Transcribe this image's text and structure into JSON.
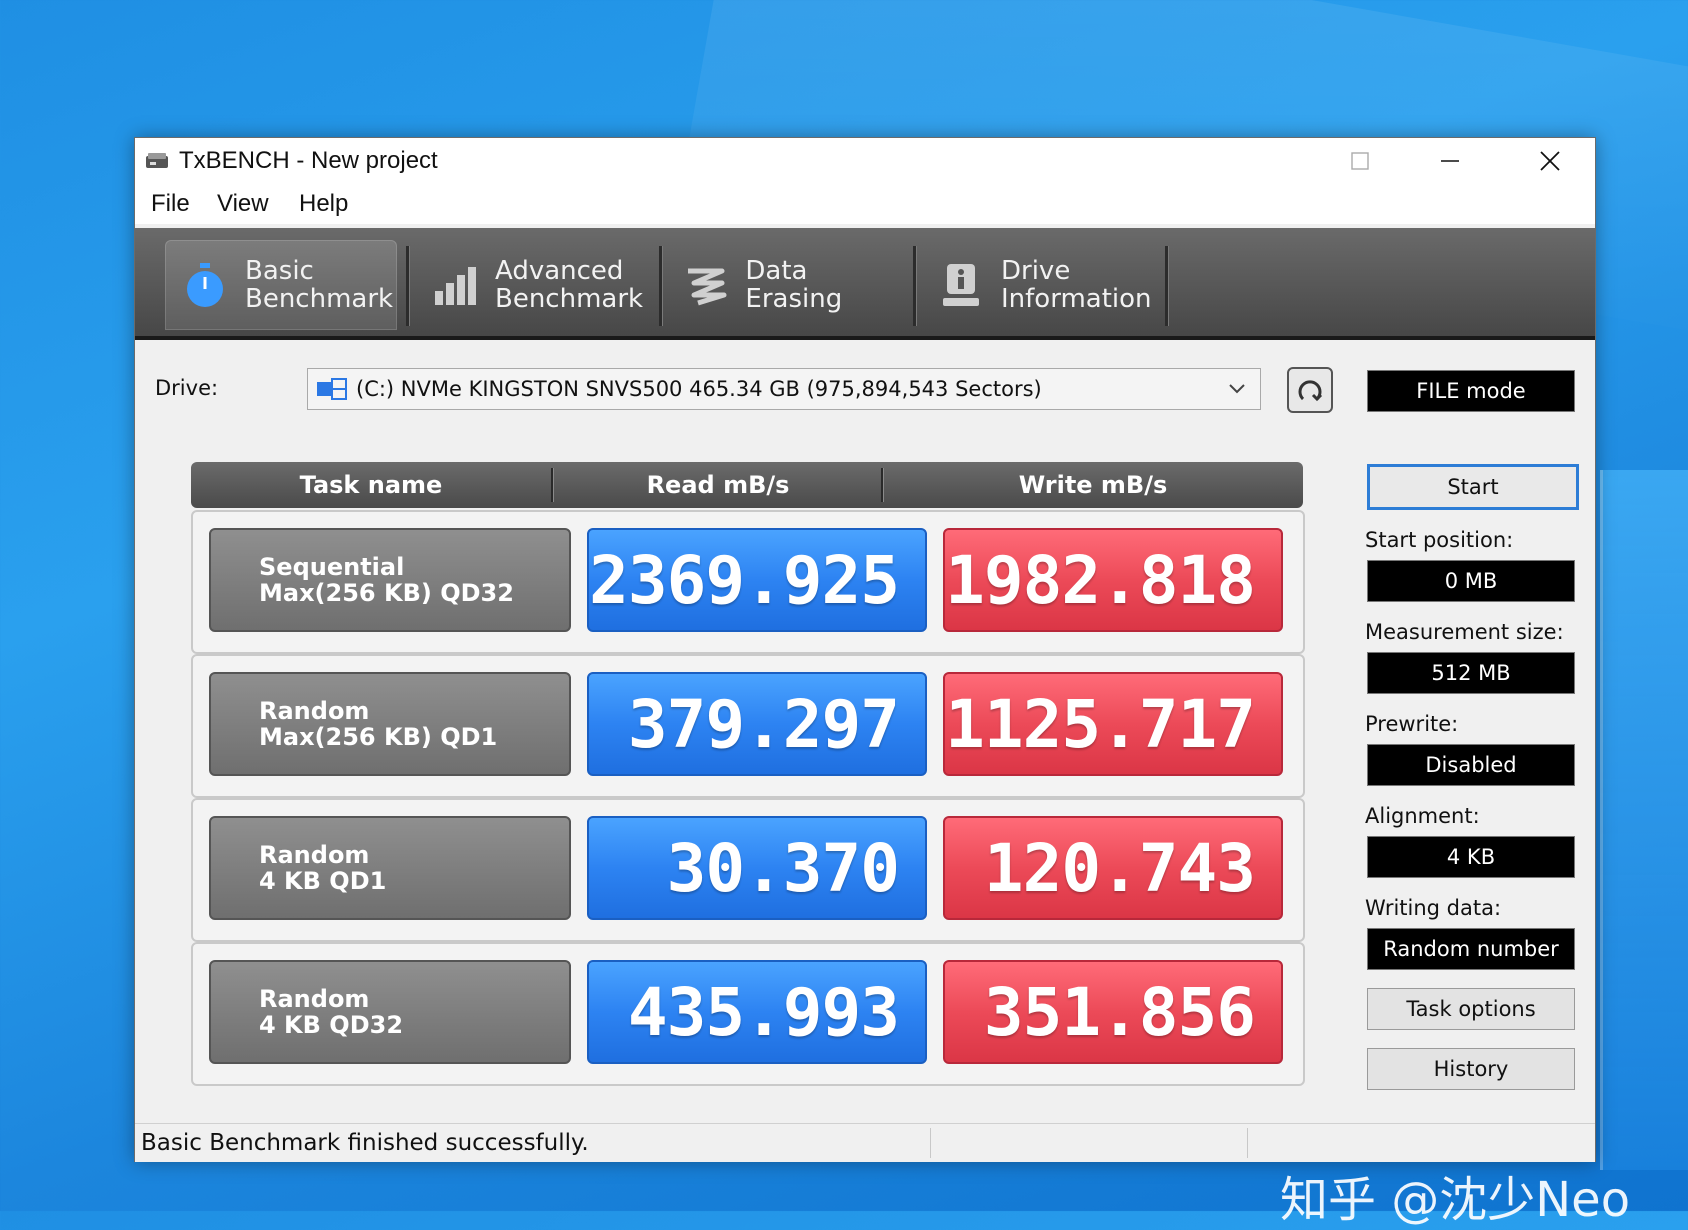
{
  "window": {
    "title": "TxBENCH - New project"
  },
  "menu": [
    "File",
    "View",
    "Help"
  ],
  "tabs": [
    {
      "line1": "Basic",
      "line2": "Benchmark",
      "icon": "stopwatch-icon",
      "active": true
    },
    {
      "line1": "Advanced",
      "line2": "Benchmark",
      "icon": "bar-chart-icon",
      "active": false
    },
    {
      "line1": "Data Erasing",
      "line2": "",
      "icon": "eraser-icon",
      "active": false
    },
    {
      "line1": "Drive",
      "line2": "Information",
      "icon": "info-drive-icon",
      "active": false
    }
  ],
  "drive": {
    "label": "Drive:",
    "selected": "(C:) NVMe KINGSTON SNVS500  465.34 GB (975,894,543 Sectors)"
  },
  "mode": "FILE mode",
  "grid": {
    "headers": [
      "Task name",
      "Read mB/s",
      "Write mB/s"
    ],
    "rows": [
      {
        "task1": "Sequential",
        "task2": "Max(256 KB) QD32",
        "read": "2369.925",
        "write": "1982.818"
      },
      {
        "task1": "Random",
        "task2": "Max(256 KB) QD1",
        "read": "379.297",
        "write": "1125.717"
      },
      {
        "task1": "Random",
        "task2": "4 KB QD1",
        "read": "30.370",
        "write": "120.743"
      },
      {
        "task1": "Random",
        "task2": "4 KB QD32",
        "read": "435.993",
        "write": "351.856"
      }
    ]
  },
  "side": {
    "start": "Start",
    "start_position_label": "Start position:",
    "start_position": "0 MB",
    "measurement_size_label": "Measurement size:",
    "measurement_size": "512 MB",
    "prewrite_label": "Prewrite:",
    "prewrite": "Disabled",
    "alignment_label": "Alignment:",
    "alignment": "4 KB",
    "writing_data_label": "Writing data:",
    "writing_data": "Random number",
    "task_options": "Task options",
    "history": "History"
  },
  "status": "Basic Benchmark finished successfully.",
  "watermark": "知乎 @沈少Neo",
  "colors": {
    "read": "#2d83f2",
    "write": "#ec4a58"
  }
}
